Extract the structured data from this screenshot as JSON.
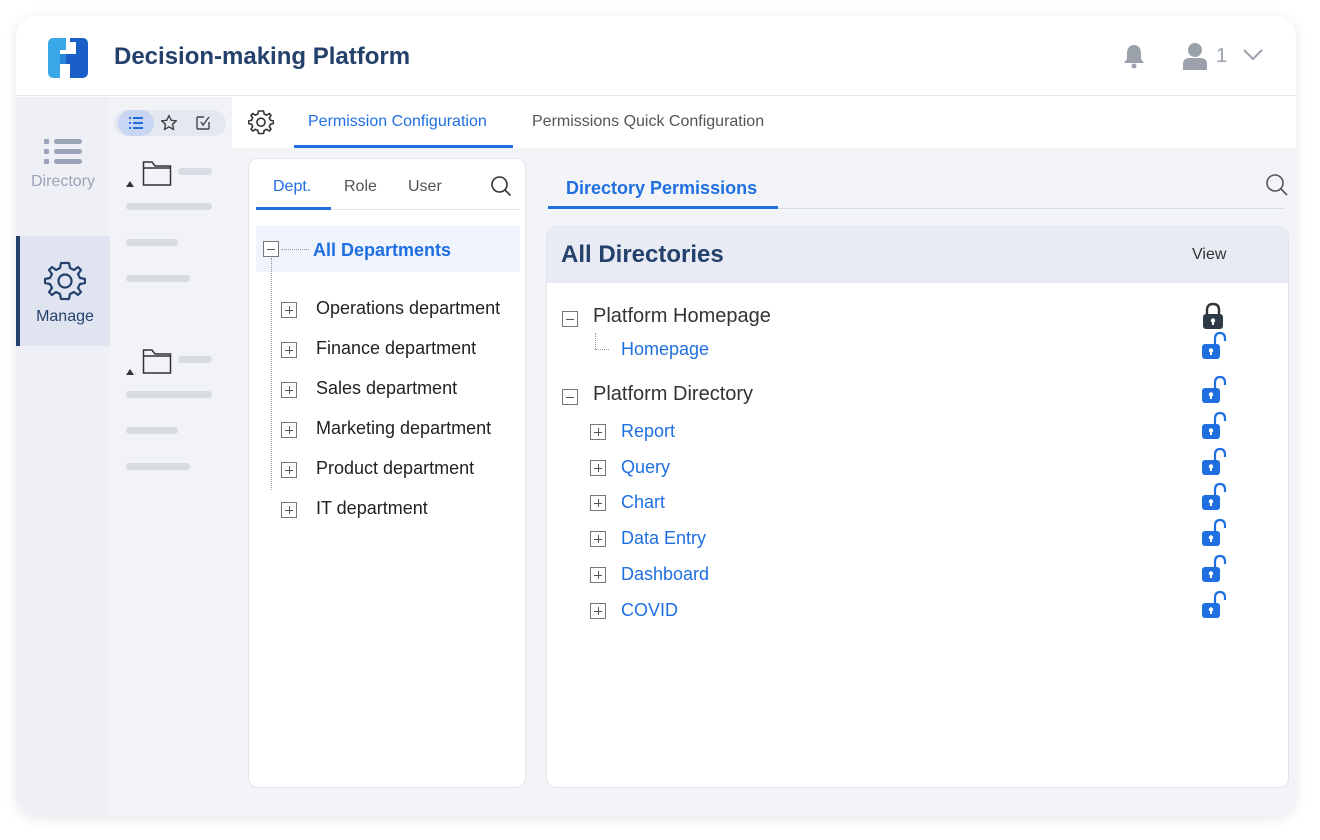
{
  "app": {
    "title": "Decision-making Platform",
    "user_count": "1"
  },
  "colors": {
    "brand": "#23416b",
    "accent": "#1f6fe0",
    "logo_light": "#3aa7e8",
    "logo_dark": "#1a5fc8"
  },
  "left_nav": {
    "items": [
      {
        "label": "Directory",
        "icon": "list-icon"
      },
      {
        "label": "Manage",
        "icon": "gear-icon"
      }
    ]
  },
  "tabs": {
    "items": [
      {
        "label": "Permission Configuration",
        "active": true
      },
      {
        "label": "Permissions Quick Configuration",
        "active": false
      }
    ]
  },
  "dept_panel": {
    "tabs": [
      "Dept.",
      "Role",
      "User"
    ],
    "root": "All Departments",
    "items": [
      "Operations department",
      "Finance department",
      "Sales department",
      "Marketing department",
      "Product department",
      "IT department"
    ]
  },
  "perm_panel": {
    "tab": "Directory Permissions",
    "header": "All Directories",
    "column": "View",
    "groups": [
      {
        "label": "Platform Homepage",
        "lock": "locked",
        "children": [
          {
            "label": "Homepage",
            "lock": "unlocked"
          }
        ]
      },
      {
        "label": "Platform Directory",
        "lock": "unlocked",
        "children": [
          {
            "label": "Report",
            "lock": "unlocked"
          },
          {
            "label": "Query",
            "lock": "unlocked"
          },
          {
            "label": "Chart",
            "lock": "unlocked"
          },
          {
            "label": "Data Entry",
            "lock": "unlocked"
          },
          {
            "label": "Dashboard",
            "lock": "unlocked"
          },
          {
            "label": "COVID",
            "lock": "unlocked"
          }
        ]
      }
    ]
  }
}
